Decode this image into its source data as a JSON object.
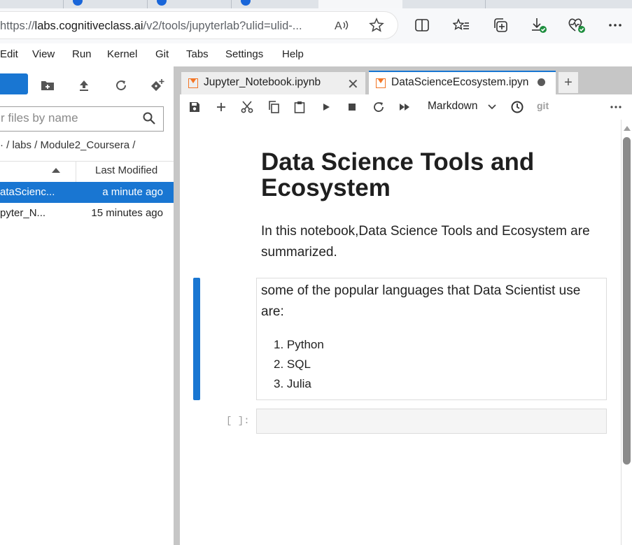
{
  "browser": {
    "url_prefix": "https://",
    "url_host": "labs.cognitiveclass.ai",
    "url_path": "/v2/tools/jupyterlab?ulid=ulid-..."
  },
  "menu": [
    "Edit",
    "View",
    "Run",
    "Kernel",
    "Git",
    "Tabs",
    "Settings",
    "Help"
  ],
  "file_browser": {
    "filter_placeholder": "r files by name",
    "breadcrumb": "·  / labs / Module2_Coursera /",
    "col_last_modified": "Last Modified",
    "files": [
      {
        "name": "ataScienc...",
        "modified": "a minute ago",
        "selected": true
      },
      {
        "name": "pyter_N...",
        "modified": "15 minutes ago",
        "selected": false
      }
    ]
  },
  "tabs": [
    {
      "label": "Jupyter_Notebook.ipynb"
    },
    {
      "label": "DataScienceEcosystem.ipyn"
    }
  ],
  "toolbar": {
    "cell_type": "Markdown",
    "git_label": "git"
  },
  "notebook": {
    "title": "Data Science Tools and Ecosystem",
    "intro": "In this notebook,Data Science Tools and Ecosystem are summarized.",
    "languages_intro": "some of the popular languages that Data Scientist use are:",
    "languages": [
      "1. Python",
      "2. SQL",
      "3. Julia"
    ],
    "code_prompt": "[ ]:"
  },
  "colors": {
    "accent": "#1976d2",
    "notebook_icon": "#f37626"
  }
}
